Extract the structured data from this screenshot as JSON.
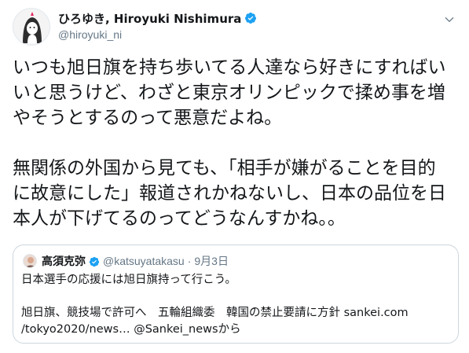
{
  "tweet": {
    "author": {
      "display_name": "ひろゆき, Hiroyuki Nishimura",
      "handle": "@hiroyuki_ni",
      "verified": true
    },
    "text_paragraphs": [
      [
        "いつも旭日旗を持ち歩いてる人達なら好きにすればい",
        "いと思うけど、わざと東京オリンピックで揉め事を増",
        "やそうとするのって悪意だよね。"
      ],
      [
        "無関係の外国から見ても、「相手が嫌がることを目的",
        "に故意にした」報道されかねないし、日本の品位を日",
        "本人が下げてるのってどうなんすかね。。"
      ]
    ]
  },
  "quoted_tweet": {
    "author": {
      "display_name": "高須克弥",
      "handle": "@katsuyatakasu",
      "separator": "·",
      "date": "9月3日",
      "verified": true
    },
    "lines": [
      "日本選手の応援には旭日旗持って行こう。",
      "",
      "旭日旗、競技場で許可へ　五輪組織委　韓国の禁止要請に方針 sankei.com",
      "/tokyo2020/news… @Sankei_newsから"
    ]
  },
  "colors": {
    "verified_blue": "#1da1f2",
    "secondary_text": "#657786",
    "border": "#ccd6dd"
  },
  "icons": {
    "verified": "verified-badge-icon",
    "more": "chevron-down-icon"
  }
}
